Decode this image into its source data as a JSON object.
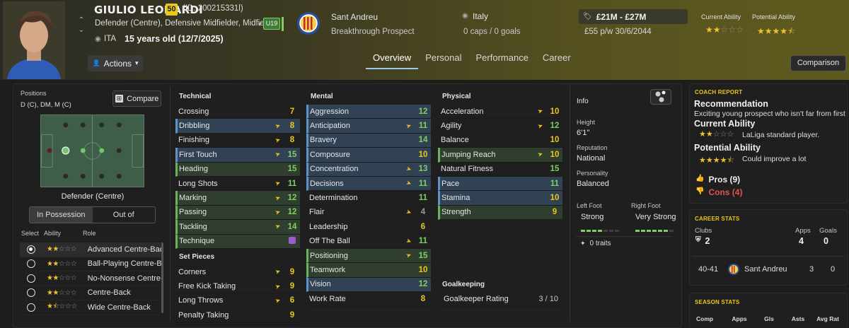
{
  "player": {
    "name": "GIULIO LEONARDI",
    "ability": "50",
    "id_text": "(ID: 200215331l)",
    "positions_text": "Defender (Centre), Defensive Midfielder, Midfiel...",
    "nationality_code": "ITA",
    "age_text": "15 years old (12/7/2025)",
    "actions_label": "Actions",
    "squad": "U19"
  },
  "club": {
    "name": "Sant Andreu",
    "status": "Breakthrough Prospect"
  },
  "nation": {
    "name": "Italy",
    "caps": "0 caps / 0 goals"
  },
  "finance": {
    "value": "£21M - £27M",
    "wage": "£55 p/w 30/6/2044"
  },
  "header_ability": {
    "current_label": "Current Ability",
    "current_stars": 2.0,
    "potential_label": "Potential Ability",
    "potential_stars": 4.5
  },
  "tabs": [
    "Overview",
    "Personal",
    "Performance",
    "Career"
  ],
  "comparison_label": "Comparison",
  "positions": {
    "label": "Positions",
    "value": "D (C), DM, M (C)",
    "compare_label": "Compare",
    "selected": "Defender (Centre)",
    "possession_tabs": [
      "In Possession",
      "Out of Possession"
    ],
    "role_headers": {
      "select": "Select",
      "ability": "Ability",
      "role": "Role"
    },
    "roles": [
      {
        "name": "Advanced Centre-Back",
        "stars": 2.0,
        "selected": true
      },
      {
        "name": "Ball-Playing Centre-Back",
        "stars": 2.0,
        "selected": false
      },
      {
        "name": "No-Nonsense Centre-Back",
        "stars": 2.0,
        "selected": false
      },
      {
        "name": "Centre-Back",
        "stars": 2.0,
        "selected": false
      },
      {
        "name": "Wide Centre-Back",
        "stars": 1.5,
        "selected": false
      }
    ]
  },
  "technical": {
    "title": "Technical",
    "rows": [
      {
        "name": "Crossing",
        "value": "7",
        "color": "yellow",
        "arrow": "",
        "hl": "",
        "bar": ""
      },
      {
        "name": "Dribbling",
        "value": "8",
        "color": "yellow",
        "arrow": "up",
        "hl": "blue",
        "bar": "blue"
      },
      {
        "name": "Finishing",
        "value": "8",
        "color": "yellow",
        "arrow": "up",
        "hl": "",
        "bar": ""
      },
      {
        "name": "First Touch",
        "value": "15",
        "color": "green",
        "arrow": "up",
        "hl": "blue",
        "bar": "blue"
      },
      {
        "name": "Heading",
        "value": "15",
        "color": "green",
        "arrow": "",
        "hl": "green",
        "bar": "green"
      },
      {
        "name": "Long Shots",
        "value": "11",
        "color": "green",
        "arrow": "up",
        "hl": "",
        "bar": ""
      },
      {
        "name": "Marking",
        "value": "12",
        "color": "green",
        "arrow": "up",
        "hl": "green",
        "bar": "green"
      },
      {
        "name": "Passing",
        "value": "12",
        "color": "green",
        "arrow": "up",
        "hl": "green",
        "bar": "green"
      },
      {
        "name": "Tackling",
        "value": "14",
        "color": "green",
        "arrow": "up",
        "hl": "green",
        "bar": "green"
      },
      {
        "name": "Technique",
        "value": "",
        "color": "purple",
        "arrow": "",
        "hl": "green",
        "bar": "green"
      }
    ]
  },
  "set_pieces": {
    "title": "Set Pieces",
    "rows": [
      {
        "name": "Corners",
        "value": "9",
        "color": "yellow",
        "arrow": "up",
        "hl": "",
        "bar": ""
      },
      {
        "name": "Free Kick Taking",
        "value": "9",
        "color": "yellow",
        "arrow": "up",
        "hl": "",
        "bar": ""
      },
      {
        "name": "Long Throws",
        "value": "6",
        "color": "yellow",
        "arrow": "up",
        "hl": "",
        "bar": ""
      },
      {
        "name": "Penalty Taking",
        "value": "9",
        "color": "yellow",
        "arrow": "",
        "hl": "",
        "bar": ""
      }
    ]
  },
  "mental": {
    "title": "Mental",
    "rows": [
      {
        "name": "Aggression",
        "value": "12",
        "color": "green",
        "arrow": "",
        "hl": "blue",
        "bar": "blue"
      },
      {
        "name": "Anticipation",
        "value": "11",
        "color": "green",
        "arrow": "up",
        "hl": "blue",
        "bar": "blue"
      },
      {
        "name": "Bravery",
        "value": "14",
        "color": "green",
        "arrow": "",
        "hl": "blue",
        "bar": "blue"
      },
      {
        "name": "Composure",
        "value": "10",
        "color": "yellow",
        "arrow": "",
        "hl": "blue",
        "bar": "blue"
      },
      {
        "name": "Concentration",
        "value": "13",
        "color": "green",
        "arrow": "down",
        "hl": "blue",
        "bar": "blue"
      },
      {
        "name": "Decisions",
        "value": "11",
        "color": "green",
        "arrow": "down",
        "hl": "blue",
        "bar": "blue"
      },
      {
        "name": "Determination",
        "value": "11",
        "color": "green",
        "arrow": "",
        "hl": "",
        "bar": ""
      },
      {
        "name": "Flair",
        "value": "4",
        "color": "grey",
        "arrow": "down",
        "hl": "",
        "bar": ""
      },
      {
        "name": "Leadership",
        "value": "6",
        "color": "yellow",
        "arrow": "",
        "hl": "",
        "bar": ""
      },
      {
        "name": "Off The Ball",
        "value": "11",
        "color": "green",
        "arrow": "down",
        "hl": "",
        "bar": ""
      },
      {
        "name": "Positioning",
        "value": "15",
        "color": "green",
        "arrow": "up",
        "hl": "green",
        "bar": "green"
      },
      {
        "name": "Teamwork",
        "value": "10",
        "color": "yellow",
        "arrow": "",
        "hl": "green",
        "bar": "green"
      },
      {
        "name": "Vision",
        "value": "12",
        "color": "green",
        "arrow": "",
        "hl": "blue",
        "bar": "blue"
      },
      {
        "name": "Work Rate",
        "value": "8",
        "color": "yellow",
        "arrow": "",
        "hl": "",
        "bar": ""
      }
    ]
  },
  "physical": {
    "title": "Physical",
    "rows": [
      {
        "name": "Acceleration",
        "value": "10",
        "color": "yellow",
        "arrow": "up",
        "hl": "",
        "bar": ""
      },
      {
        "name": "Agility",
        "value": "12",
        "color": "green",
        "arrow": "up",
        "hl": "",
        "bar": ""
      },
      {
        "name": "Balance",
        "value": "10",
        "color": "yellow",
        "arrow": "",
        "hl": "",
        "bar": ""
      },
      {
        "name": "Jumping Reach",
        "value": "10",
        "color": "yellow",
        "arrow": "up",
        "hl": "green",
        "bar": "green"
      },
      {
        "name": "Natural Fitness",
        "value": "15",
        "color": "green",
        "arrow": "",
        "hl": "",
        "bar": ""
      },
      {
        "name": "Pace",
        "value": "11",
        "color": "green",
        "arrow": "",
        "hl": "blue",
        "bar": "blue"
      },
      {
        "name": "Stamina",
        "value": "10",
        "color": "yellow",
        "arrow": "",
        "hl": "blue",
        "bar": "blue"
      },
      {
        "name": "Strength",
        "value": "9",
        "color": "yellow",
        "arrow": "",
        "hl": "green",
        "bar": "green"
      }
    ]
  },
  "goalkeeping": {
    "title": "Goalkeeping",
    "label": "Goalkeeper Rating",
    "value": "3 / 10"
  },
  "info": {
    "title": "Info",
    "height_label": "Height",
    "height": "6'1\"",
    "reputation_label": "Reputation",
    "reputation": "National",
    "personality_label": "Personality",
    "personality": "Balanced",
    "left_foot_label": "Left Foot",
    "left_foot": "Strong",
    "left_foot_level": 0.6,
    "right_foot_label": "Right Foot",
    "right_foot": "Very Strong",
    "right_foot_level": 0.8,
    "traits_label": "0 traits"
  },
  "coach_report": {
    "title": "COACH REPORT",
    "recommendation_title": "Recommendation",
    "recommendation_text": "Exciting young prospect who isn't far from first ...",
    "current_title": "Current Ability",
    "current_text": "LaLiga standard player.",
    "current_stars": 2.0,
    "potential_title": "Potential Ability",
    "potential_text": "Could improve a lot",
    "potential_stars": 4.5,
    "pros_label": "Pros (9)",
    "cons_label": "Cons (4)"
  },
  "career_stats": {
    "title": "CAREER STATS",
    "headers": [
      "Clubs",
      "Apps",
      "Goals"
    ],
    "clubs": "2",
    "apps": "4",
    "goals": "0",
    "row": {
      "season": "40-41",
      "club": "Sant Andreu",
      "apps": "3",
      "goals": "0"
    }
  },
  "season_stats": {
    "title": "SEASON STATS",
    "headers": [
      "Comp",
      "Apps",
      "Gls",
      "Asts",
      "Avg Rat"
    ]
  },
  "colors": {
    "green": "#7ed060",
    "yellow": "#e9c81e",
    "grey": "#9a9a9a",
    "purple": "#9c5ad0",
    "highlight_blue": "#324255",
    "highlight_green": "#2f3e2e"
  }
}
